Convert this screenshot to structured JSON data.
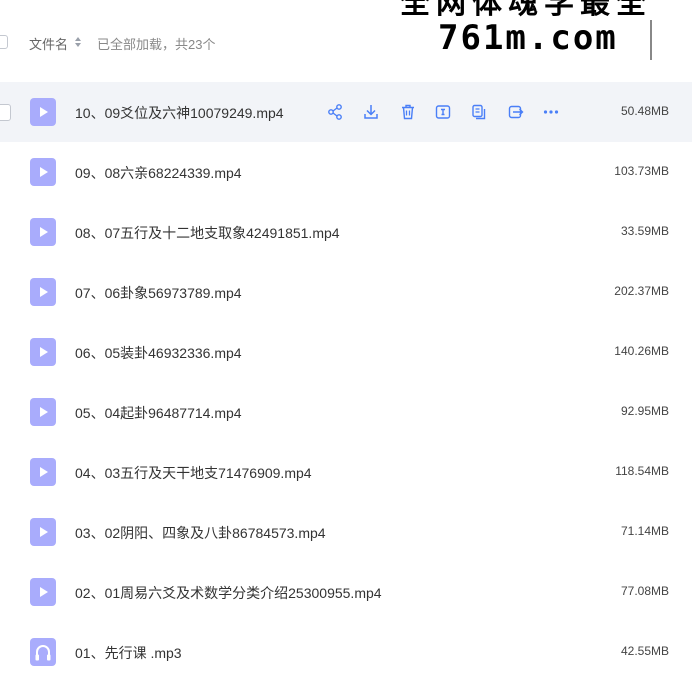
{
  "watermark": {
    "top_text": "全网体魂学最全",
    "site": "761m.com"
  },
  "header": {
    "name_label": "文件名",
    "status": "已全部加载，共23个"
  },
  "files": [
    {
      "name": "10、09爻位及六神10079249.mp4",
      "size": "50.48MB",
      "type": "video"
    },
    {
      "name": "09、08六亲68224339.mp4",
      "size": "103.73MB",
      "type": "video"
    },
    {
      "name": "08、07五行及十二地支取象42491851.mp4",
      "size": "33.59MB",
      "type": "video"
    },
    {
      "name": "07、06卦象56973789.mp4",
      "size": "202.37MB",
      "type": "video"
    },
    {
      "name": "06、05装卦46932336.mp4",
      "size": "140.26MB",
      "type": "video"
    },
    {
      "name": "05、04起卦96487714.mp4",
      "size": "92.95MB",
      "type": "video"
    },
    {
      "name": "04、03五行及天干地支71476909.mp4",
      "size": "118.54MB",
      "type": "video"
    },
    {
      "name": "03、02阴阳、四象及八卦86784573.mp4",
      "size": "71.14MB",
      "type": "video"
    },
    {
      "name": "02、01周易六爻及术数学分类介绍25300955.mp4",
      "size": "77.08MB",
      "type": "video"
    },
    {
      "name": "01、先行课 .mp3",
      "size": "42.55MB",
      "type": "audio"
    }
  ],
  "row_actions": [
    "share-icon",
    "download-icon",
    "delete-icon",
    "rename-icon",
    "copy-icon",
    "move-icon",
    "more-icon"
  ],
  "colors": {
    "file_icon": "#a9acfc",
    "action": "#4a7ff7",
    "hover_row": "#f2f4f8"
  }
}
